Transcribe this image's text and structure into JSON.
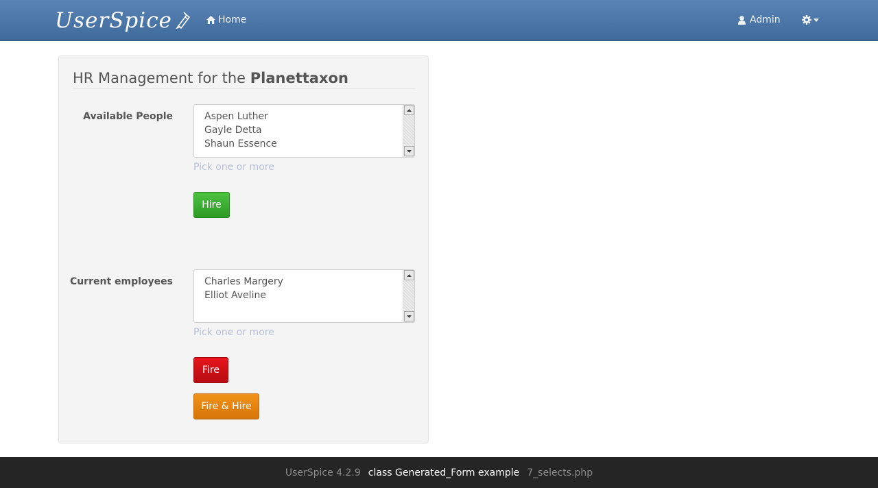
{
  "navbar": {
    "brand": "UserSpice",
    "home_label": "Home",
    "user_label": "Admin",
    "bg_color": "#4a75a8"
  },
  "panel": {
    "title_prefix": "HR Management for the",
    "title_org": "Planettaxon",
    "available": {
      "label": "Available People",
      "options": [
        "Aspen Luther",
        "Gayle Detta",
        "Shaun Essence"
      ],
      "help": "Pick one or more"
    },
    "hire_button": "Hire",
    "employees": {
      "label": "Current employees",
      "options": [
        "Charles Margery",
        "Elliot Aveline"
      ],
      "help": "Pick one or more"
    },
    "fire_button": "Fire",
    "fire_hire_button": "Fire & Hire"
  },
  "footer": {
    "version": "UserSpice 4.2.9",
    "example": "class Generated_Form example",
    "file": "7_selects.php"
  },
  "colors": {
    "hire": "#3cae32",
    "fire": "#d0111a",
    "fire_hire": "#e8860f"
  }
}
